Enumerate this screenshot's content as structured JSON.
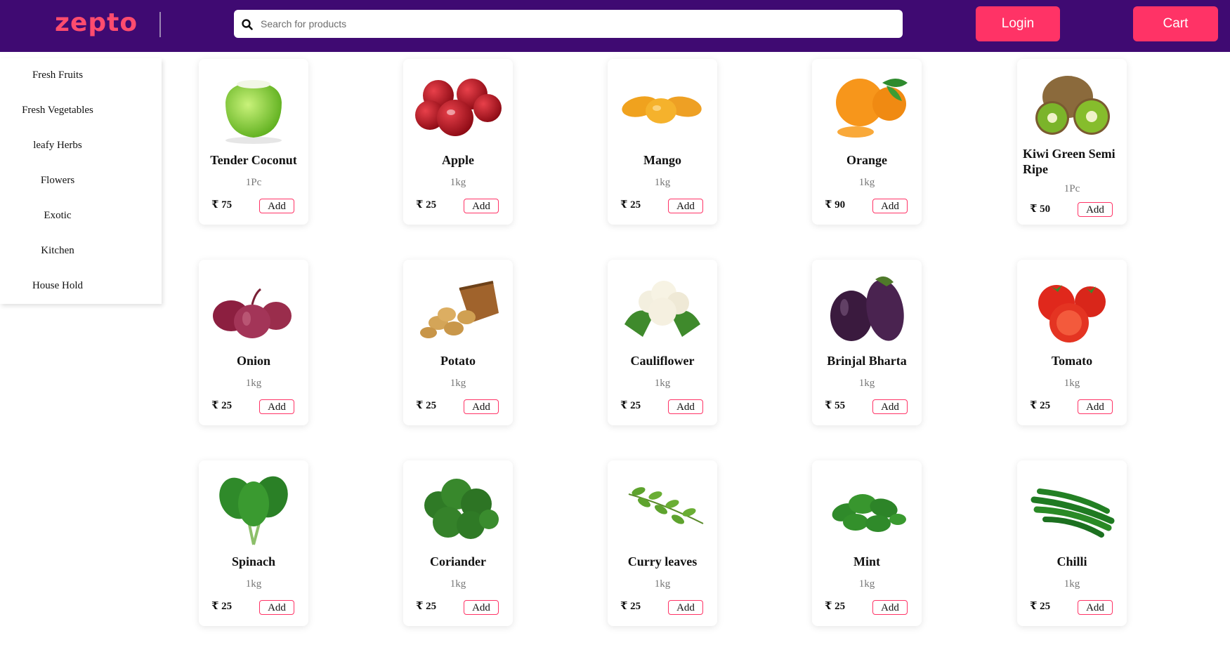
{
  "header": {
    "logo": "zepto",
    "search_placeholder": "Search for products",
    "login_label": "Login",
    "cart_label": "Cart"
  },
  "sidebar": {
    "items": [
      {
        "label": "Fresh Fruits"
      },
      {
        "label": "Fresh Vegetables"
      },
      {
        "label": "leafy Herbs"
      },
      {
        "label": "Flowers"
      },
      {
        "label": "Exotic"
      },
      {
        "label": "Kitchen"
      },
      {
        "label": "House Hold"
      }
    ]
  },
  "colors": {
    "header_bg": "#3f0a72",
    "accent": "#ff3366",
    "logo": "#ff4c6e"
  },
  "products": [
    {
      "name": "Tender Coconut",
      "qty": "1Pc",
      "price": "₹ 75",
      "add": "Add",
      "icon": "coconut-icon"
    },
    {
      "name": "Apple",
      "qty": "1kg",
      "price": "₹ 25",
      "add": "Add",
      "icon": "apple-icon"
    },
    {
      "name": "Mango",
      "qty": "1kg",
      "price": "₹ 25",
      "add": "Add",
      "icon": "mango-icon"
    },
    {
      "name": "Orange",
      "qty": "1kg",
      "price": "₹ 90",
      "add": "Add",
      "icon": "orange-icon"
    },
    {
      "name": "Kiwi Green Semi Ripe",
      "qty": "1Pc",
      "price": "₹ 50",
      "add": "Add",
      "icon": "kiwi-icon"
    },
    {
      "name": "Onion",
      "qty": "1kg",
      "price": "₹ 25",
      "add": "Add",
      "icon": "onion-icon"
    },
    {
      "name": "Potato",
      "qty": "1kg",
      "price": "₹ 25",
      "add": "Add",
      "icon": "potato-icon"
    },
    {
      "name": "Cauliflower",
      "qty": "1kg",
      "price": "₹ 25",
      "add": "Add",
      "icon": "cauliflower-icon"
    },
    {
      "name": "Brinjal Bharta",
      "qty": "1kg",
      "price": "₹ 55",
      "add": "Add",
      "icon": "brinjal-icon"
    },
    {
      "name": "Tomato",
      "qty": "1kg",
      "price": "₹ 25",
      "add": "Add",
      "icon": "tomato-icon"
    },
    {
      "name": "Spinach",
      "qty": "1kg",
      "price": "₹ 25",
      "add": "Add",
      "icon": "spinach-icon"
    },
    {
      "name": "Coriander",
      "qty": "1kg",
      "price": "₹ 25",
      "add": "Add",
      "icon": "coriander-icon"
    },
    {
      "name": "Curry leaves",
      "qty": "1kg",
      "price": "₹ 25",
      "add": "Add",
      "icon": "curry-leaves-icon"
    },
    {
      "name": "Mint",
      "qty": "1kg",
      "price": "₹ 25",
      "add": "Add",
      "icon": "mint-icon"
    },
    {
      "name": "Chilli",
      "qty": "1kg",
      "price": "₹ 25",
      "add": "Add",
      "icon": "chilli-icon"
    }
  ]
}
